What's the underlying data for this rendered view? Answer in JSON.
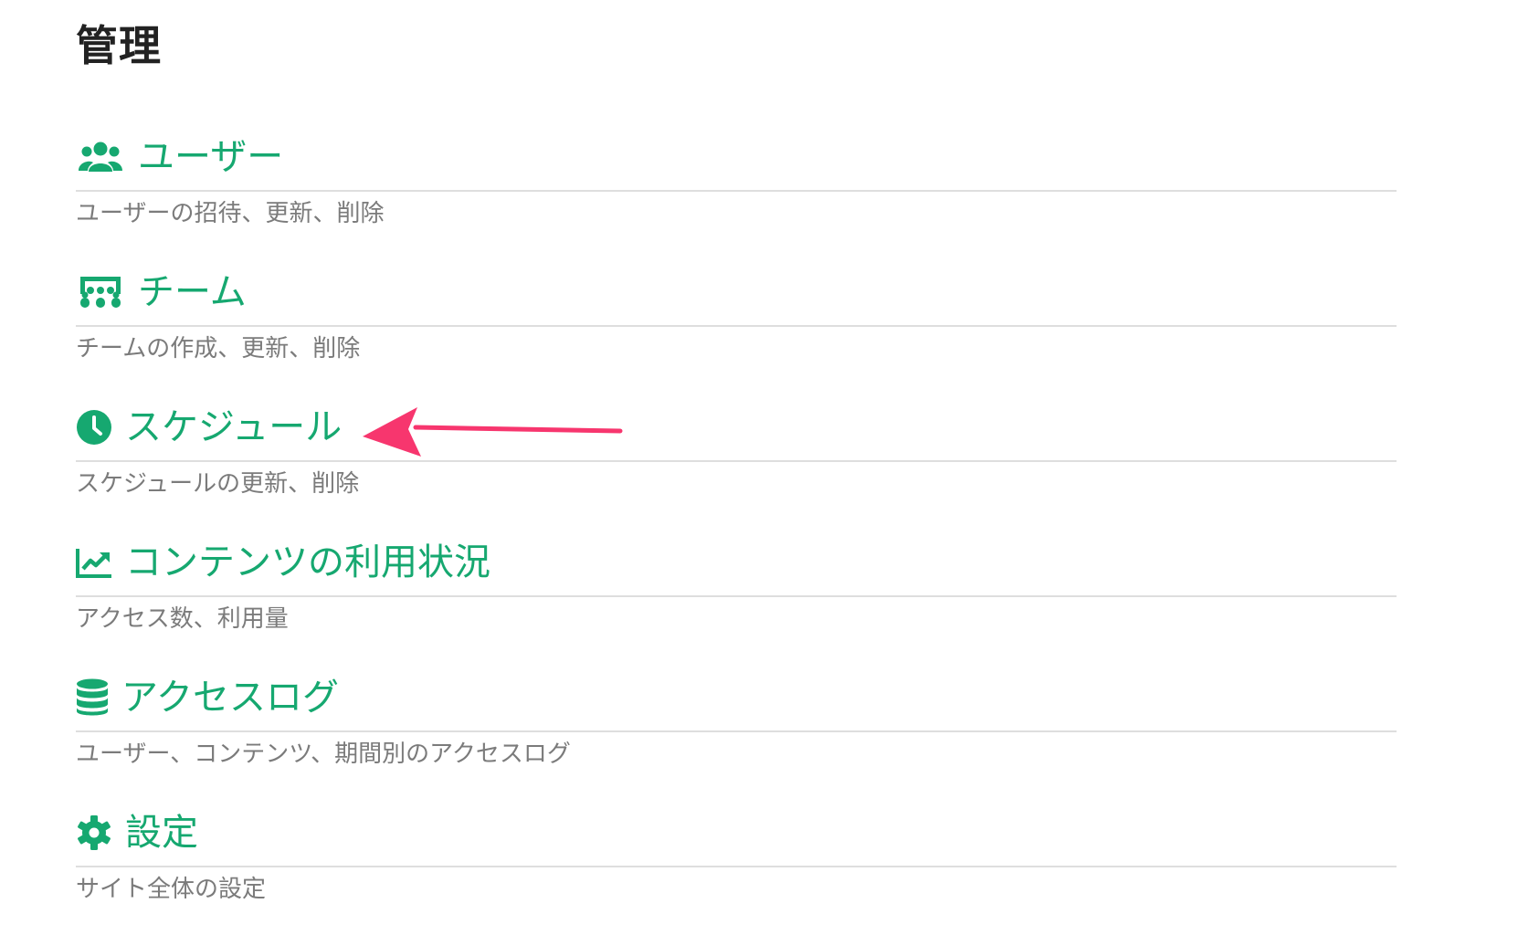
{
  "page": {
    "title": "管理"
  },
  "sections": [
    {
      "icon": "users-icon",
      "title": "ユーザー",
      "description": "ユーザーの招待、更新、削除"
    },
    {
      "icon": "team-icon",
      "title": "チーム",
      "description": "チームの作成、更新、削除"
    },
    {
      "icon": "clock-icon",
      "title": "スケジュール",
      "description": "スケジュールの更新、削除"
    },
    {
      "icon": "chart-line-icon",
      "title": "コンテンツの利用状況",
      "description": "アクセス数、利用量"
    },
    {
      "icon": "database-icon",
      "title": "アクセスログ",
      "description": "ユーザー、コンテンツ、期間別のアクセスログ"
    },
    {
      "icon": "gear-icon",
      "title": "設定",
      "description": "サイト全体の設定"
    }
  ],
  "colors": {
    "accent": "#16a870",
    "text_muted": "#7b7b7b",
    "divider": "#dedede",
    "annotation_arrow": "#f7366e"
  },
  "annotation": {
    "type": "arrow",
    "target": "sections.2"
  }
}
